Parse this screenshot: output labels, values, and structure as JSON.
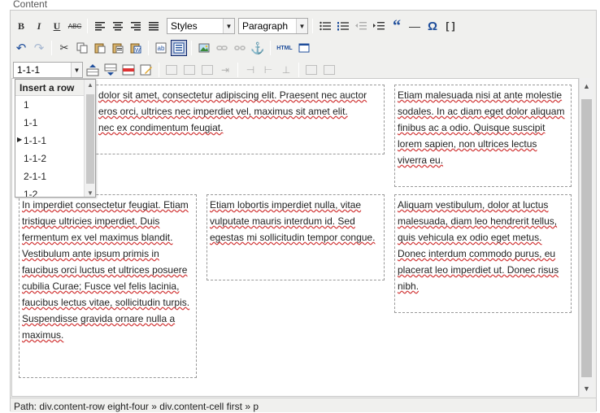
{
  "fieldset": {
    "legend": "Content"
  },
  "toolbar1": {
    "bold": "B",
    "italic": "I",
    "underline": "U",
    "strike": "ABC",
    "styles_value": "Styles",
    "format_value": "Paragraph",
    "blockquote": "“",
    "hr": "—",
    "omega": "Ω",
    "brackets": "[ ]"
  },
  "toolbar2": {
    "html_label": "HTML"
  },
  "toolbar3": {
    "layout_select_value": "1-1-1"
  },
  "dropdown": {
    "header": "Insert a row",
    "items": [
      {
        "label": "1"
      },
      {
        "label": "1-1"
      },
      {
        "label": "1-1-1",
        "marker": "▶"
      },
      {
        "label": "1-1-2"
      },
      {
        "label": "2-1-1"
      },
      {
        "label": "1-2"
      }
    ]
  },
  "content": {
    "cell_top_wide": "Lorem ipsum dolor sit amet, consectetur adipiscing elit. Praesent nec auctor tellus. Fusce eros orci, ultrices nec imperdiet vel, maximus sit amet elit. Pellentesque nec ex condimentum feugiat.",
    "cell_top_wide_visible": "dolor sit amet, consectetur adipiscing elit. Praesent nec auctor",
    "cell_top_wide_visible_2": "eros orci, ultrices nec imperdiet vel, maximus sit amet elit.",
    "cell_top_wide_visible_3": "nec ex condimentum feugiat.",
    "cell_top_right": "Etiam malesuada nisi at ante molestie sodales. In ac diam eget dolor aliquam finibus ac a odio. Quisque suscipit lorem sapien, non ultrices lectus viverra eu.",
    "cell_bottom_left": "In imperdiet consectetur feugiat. Etiam tristique ultricies imperdiet. Duis fermentum ex vel maximus blandit. Vestibulum ante ipsum primis in faucibus orci luctus et ultrices posuere cubilia Curae; Fusce vel felis lacinia, faucibus lectus vitae, sollicitudin turpis. Suspendisse gravida ornare nulla a maximus.",
    "cell_bottom_middle": "Etiam lobortis imperdiet nulla, vitae vulputate mauris interdum id. Sed egestas mi sollicitudin tempor congue.",
    "cell_bottom_right": "Aliquam vestibulum, dolor at luctus malesuada, diam leo hendrerit tellus, quis vehicula ex odio eget metus. Donec interdum commodo purus, eu placerat leo imperdiet ut. Donec risus nibh."
  },
  "status": {
    "path": "Path: div.content-row eight-four » div.content-cell first » p"
  },
  "colors": {
    "accent": "#1f4e9b",
    "frame_bg": "#f0f0ee",
    "spell_error": "#d23a3a"
  }
}
